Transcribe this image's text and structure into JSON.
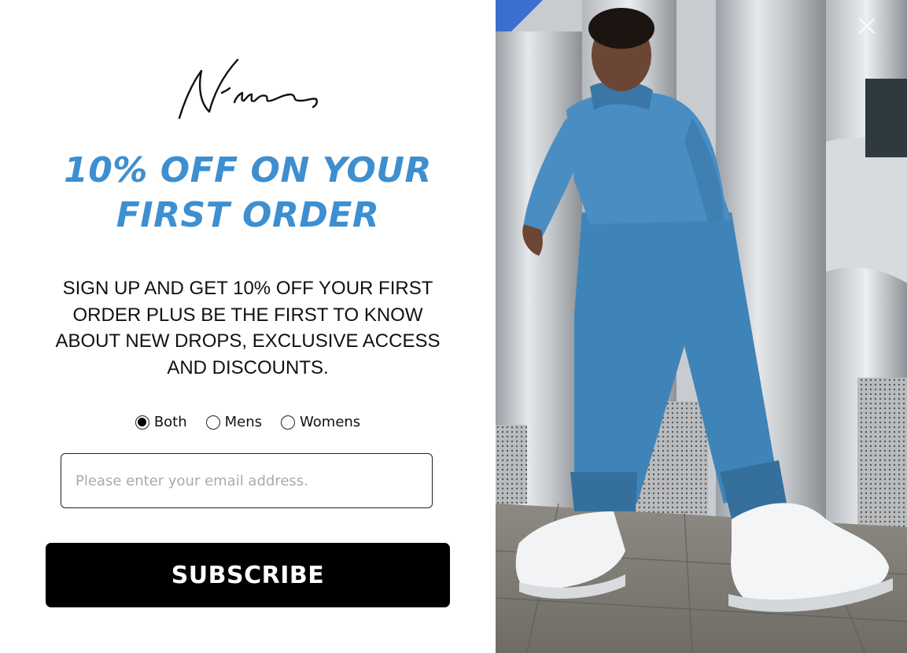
{
  "popup": {
    "logo_text": "Nimes,",
    "headline": {
      "line1": "10% OFF ON YOUR",
      "line2": "FIRST ORDER"
    },
    "body": "SIGN UP AND GET 10% OFF YOUR FIRST ORDER PLUS BE THE FIRST TO KNOW ABOUT NEW DROPS, EXCLUSIVE ACCESS AND DISCOUNTS.",
    "gender_options": [
      {
        "label": "Both",
        "selected": true
      },
      {
        "label": "Mens",
        "selected": false
      },
      {
        "label": "Womens",
        "selected": false
      }
    ],
    "email": {
      "value": "",
      "placeholder": "Please enter your email address."
    },
    "subscribe_label": "SUBSCRIBE",
    "close_icon": "close-icon"
  },
  "colors": {
    "headline": "#3d8fd0",
    "button_bg": "#000000",
    "button_text": "#ffffff",
    "tracksuit": "#3f84b8"
  }
}
